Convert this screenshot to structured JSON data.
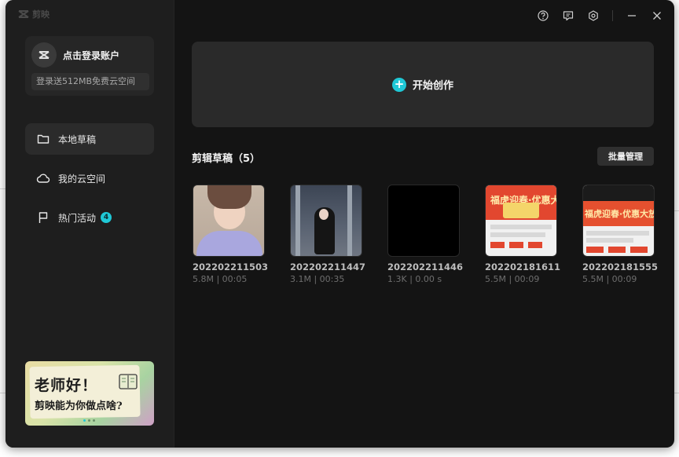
{
  "app": {
    "name": "剪映"
  },
  "account": {
    "login_label": "点击登录账户",
    "cloud_promo": "登录送512MB免费云空间"
  },
  "nav": [
    {
      "label": "本地草稿",
      "icon": "folder-icon",
      "active": true
    },
    {
      "label": "我的云空间",
      "icon": "cloud-icon",
      "active": false
    },
    {
      "label": "热门活动",
      "icon": "flag-icon",
      "active": false,
      "badge": "4"
    }
  ],
  "banner": {
    "line1": "老师好！",
    "line2": "剪映能为你做点啥?"
  },
  "toolbar": {
    "icons": [
      "help-icon",
      "feedback-icon",
      "settings-icon",
      "minimize-icon",
      "close-icon"
    ]
  },
  "create": {
    "label": "开始创作"
  },
  "drafts": {
    "title": "剪辑草稿（5）",
    "batch_label": "批量管理",
    "items": [
      {
        "name": "202202211503",
        "meta": "5.8M | 00:05"
      },
      {
        "name": "202202211447",
        "meta": "3.1M | 00:35"
      },
      {
        "name": "202202211446",
        "meta": "1.3K | 0.00 s"
      },
      {
        "name": "202202181611",
        "meta": "5.5M | 00:09"
      },
      {
        "name": "202202181555",
        "meta": "5.5M | 00:09"
      }
    ]
  },
  "thumb_text": {
    "t4_header": "福虎迎春·优惠大放",
    "t5_header": "福虎迎春·优惠大放"
  },
  "colors": {
    "accent": "#1fc8d6",
    "window_bg": "#141414",
    "sidebar_bg": "#1e1e1e"
  }
}
